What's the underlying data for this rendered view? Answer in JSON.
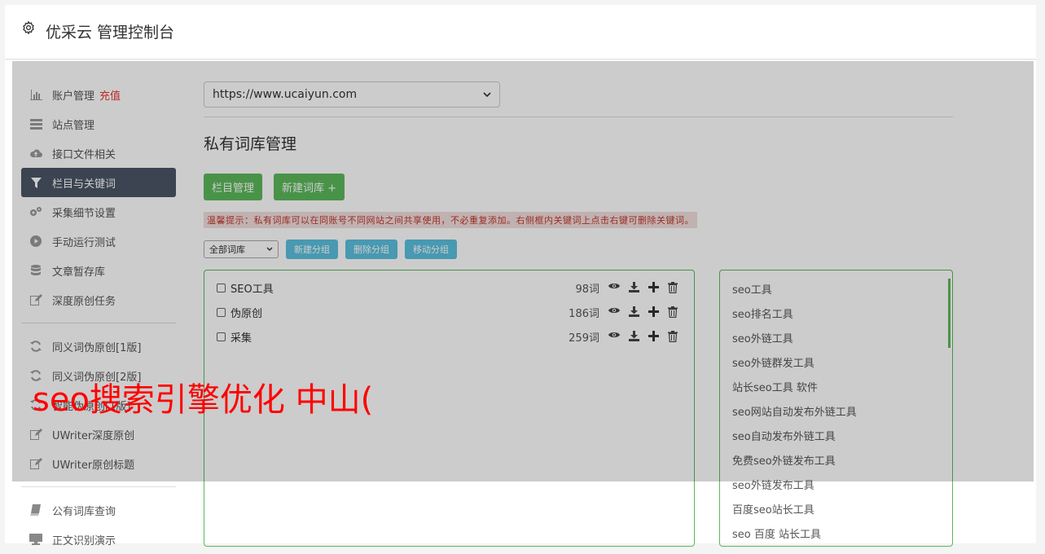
{
  "header": {
    "title": "优采云 管理控制台",
    "icon": "gear-icon"
  },
  "sidebar": {
    "group1": [
      {
        "label": "账户管理",
        "badge": "充值",
        "icon": "bar-chart-icon"
      },
      {
        "label": "站点管理",
        "icon": "server-icon"
      },
      {
        "label": "接口文件相关",
        "icon": "cloud-upload-icon"
      },
      {
        "label": "栏目与关键词",
        "icon": "filter-icon",
        "active": true
      },
      {
        "label": "采集细节设置",
        "icon": "cogs-icon"
      },
      {
        "label": "手动运行测试",
        "icon": "play-circle-icon"
      },
      {
        "label": "文章暂存库",
        "icon": "database-icon"
      },
      {
        "label": "深度原创任务",
        "icon": "edit-icon"
      }
    ],
    "group2": [
      {
        "label": "同义词伪原创[1版]",
        "icon": "refresh-icon"
      },
      {
        "label": "同义词伪原创[2版]",
        "icon": "refresh-icon"
      },
      {
        "label": "智能伪原创[1版]",
        "icon": "refresh-icon"
      },
      {
        "label": "UWriter深度原创",
        "icon": "edit-icon"
      },
      {
        "label": "UWriter原创标题",
        "icon": "edit-icon"
      }
    ],
    "group3": [
      {
        "label": "公有词库查询",
        "icon": "book-icon"
      },
      {
        "label": "正文识别演示",
        "icon": "monitor-icon"
      }
    ]
  },
  "site_select": {
    "value": "https://www.ucaiyun.com"
  },
  "page_title": "私有词库管理",
  "buttons": {
    "column_manage": "栏目管理",
    "new_lib": "新建词库 +"
  },
  "tip": "温馨提示：私有词库可以在同账号不同网站之间共享使用，不必重复添加。右侧框内关键词上点击右键可删除关键词。",
  "lib_filter": {
    "value": "全部词库"
  },
  "group_buttons": {
    "new_group": "新建分组",
    "delete_group": "删除分组",
    "move_group": "移动分组"
  },
  "libraries": [
    {
      "name": "SEO工具",
      "count": "98词"
    },
    {
      "name": "伪原创",
      "count": "186词"
    },
    {
      "name": "采集",
      "count": "259词"
    }
  ],
  "keywords": [
    "seo工具",
    "seo排名工具",
    "seo外链工具",
    "seo外链群发工具",
    "站长seo工具 软件",
    "seo网站自动发布外链工具",
    "seo自动发布外链工具",
    "免费seo外链发布工具",
    "seo外链发布工具",
    "百度seo站长工具",
    "seo 百度 站长工具"
  ],
  "overlay_text": "seo搜索引擎优化 中山("
}
